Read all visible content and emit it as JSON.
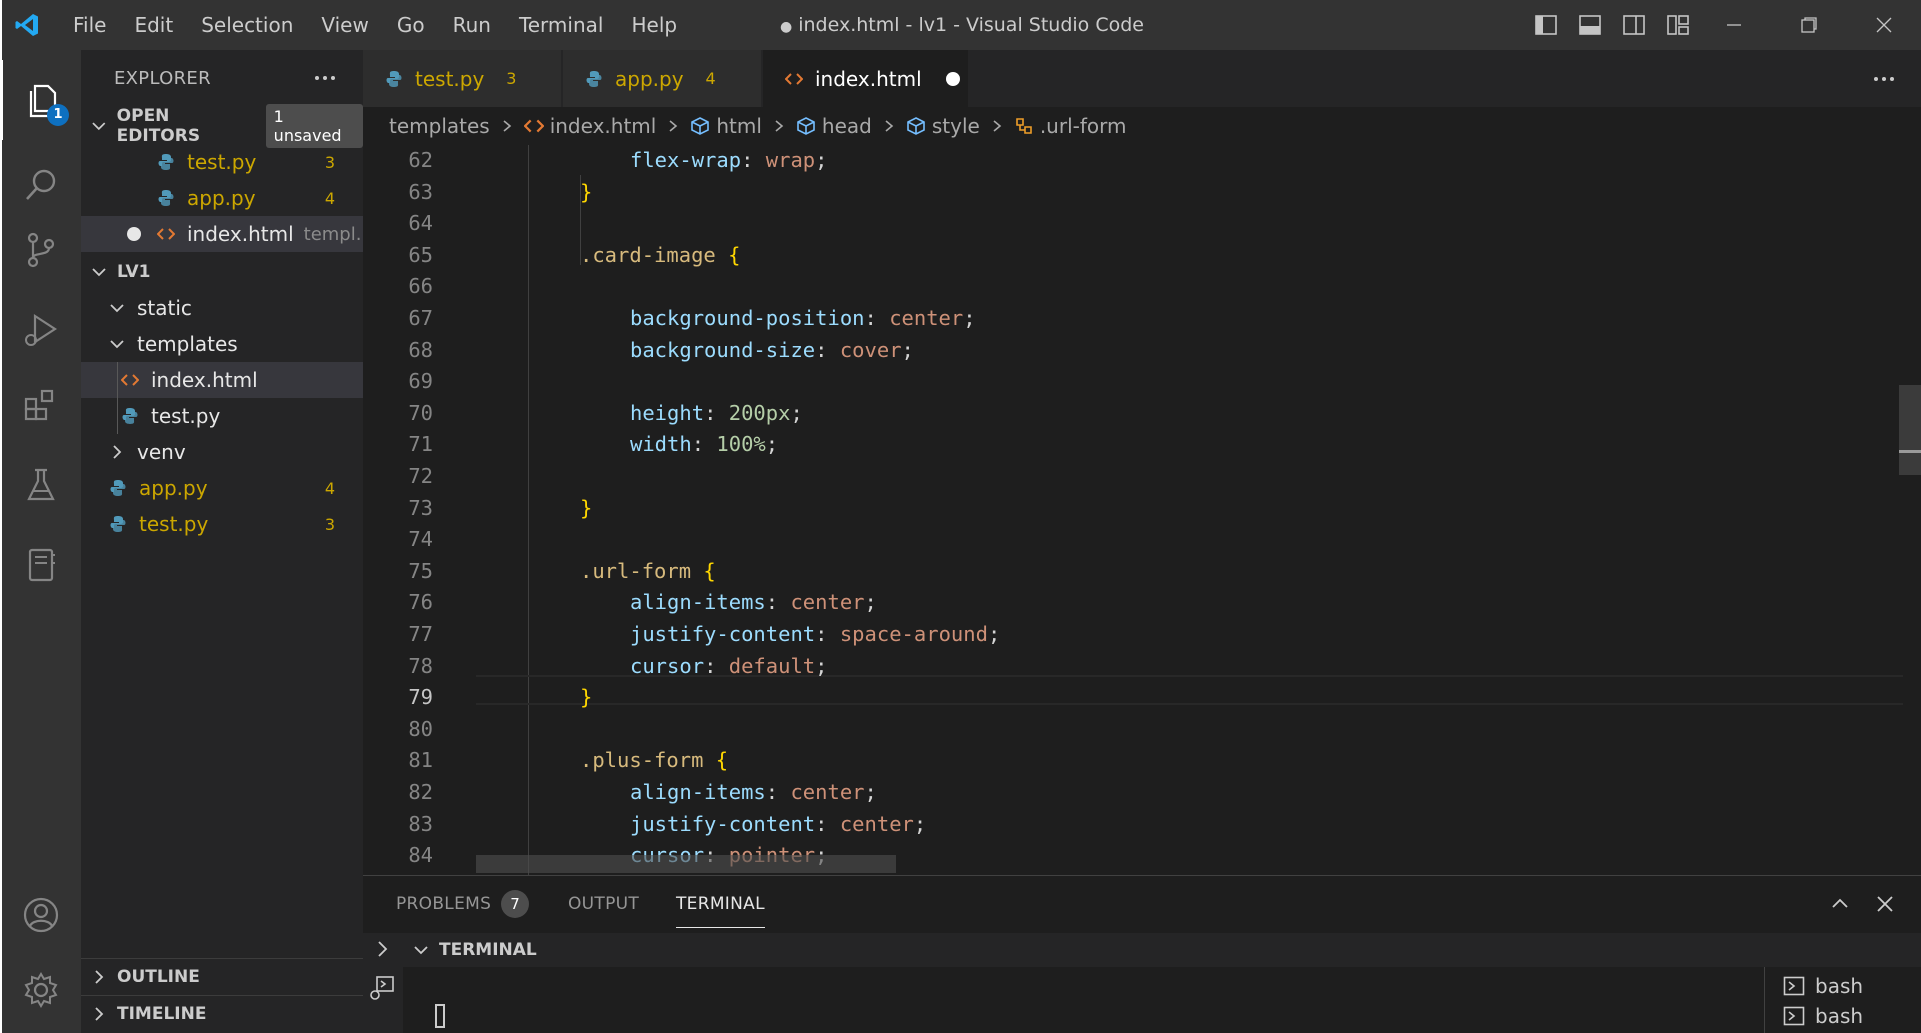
{
  "titlebar": {
    "menu": [
      "File",
      "Edit",
      "Selection",
      "View",
      "Go",
      "Run",
      "Terminal",
      "Help"
    ],
    "title": "index.html - lv1 - Visual Studio Code",
    "dirty_dot": "●"
  },
  "activity": {
    "explorer_badge": "1",
    "icons": [
      "explorer-icon",
      "search-icon",
      "source-control-icon",
      "run-debug-icon",
      "extensions-icon",
      "testing-icon",
      "notebook-icon",
      "account-icon",
      "settings-gear-icon"
    ]
  },
  "sidebar": {
    "title": "EXPLORER",
    "open_editors": {
      "label": "OPEN EDITORS",
      "badge": "1 unsaved",
      "items": [
        {
          "name": "test.py",
          "count": "3"
        },
        {
          "name": "app.py",
          "count": "4"
        },
        {
          "name": "index.html",
          "desc": "templ..."
        }
      ]
    },
    "workspace": {
      "label": "LV1",
      "tree": [
        {
          "name": "static"
        },
        {
          "name": "templates"
        },
        {
          "name": "index.html"
        },
        {
          "name": "test.py"
        },
        {
          "name": "venv"
        },
        {
          "name": "app.py",
          "count": "4"
        },
        {
          "name": "test.py",
          "count": "3"
        }
      ]
    },
    "outline": "OUTLINE",
    "timeline": "TIMELINE"
  },
  "tabs": [
    {
      "name": "test.py",
      "count": "3"
    },
    {
      "name": "app.py",
      "count": "4"
    },
    {
      "name": "index.html"
    }
  ],
  "breadcrumb": [
    "templates",
    "index.html",
    "html",
    "head",
    "style",
    ".url-form"
  ],
  "editor": {
    "current_line": 79,
    "lines": [
      {
        "n": "62"
      },
      {
        "n": "63"
      },
      {
        "n": "64"
      },
      {
        "n": "65"
      },
      {
        "n": "66"
      },
      {
        "n": "67"
      },
      {
        "n": "68"
      },
      {
        "n": "69"
      },
      {
        "n": "70"
      },
      {
        "n": "71"
      },
      {
        "n": "72"
      },
      {
        "n": "73"
      },
      {
        "n": "74"
      },
      {
        "n": "75"
      },
      {
        "n": "76"
      },
      {
        "n": "77"
      },
      {
        "n": "78"
      },
      {
        "n": "79"
      },
      {
        "n": "80"
      },
      {
        "n": "81"
      },
      {
        "n": "82"
      },
      {
        "n": "83"
      },
      {
        "n": "84"
      }
    ],
    "code": {
      "l62_prop": "flex-wrap",
      "l62_val": "wrap",
      "l65_sel": ".card-image",
      "l67_prop": "background-position",
      "l67_val": "center",
      "l68_prop": "background-size",
      "l68_val": "cover",
      "l70_prop": "height",
      "l70_val": "200px",
      "l71_prop": "width",
      "l71_val": "100%",
      "l75_sel": ".url-form",
      "l76_prop": "align-items",
      "l76_val": "center",
      "l77_prop": "justify-content",
      "l77_val": "space-around",
      "l78_prop": "cursor",
      "l78_val": "default",
      "l81_sel": ".plus-form",
      "l82_prop": "align-items",
      "l82_val": "center",
      "l83_prop": "justify-content",
      "l83_val": "center",
      "l84_prop": "cursor",
      "l84_val": "pointer"
    }
  },
  "panel": {
    "tabs": [
      "PROBLEMS",
      "OUTPUT",
      "TERMINAL"
    ],
    "problems_count": "7",
    "terminal_header": "TERMINAL",
    "terminals": [
      "bash",
      "bash"
    ]
  }
}
